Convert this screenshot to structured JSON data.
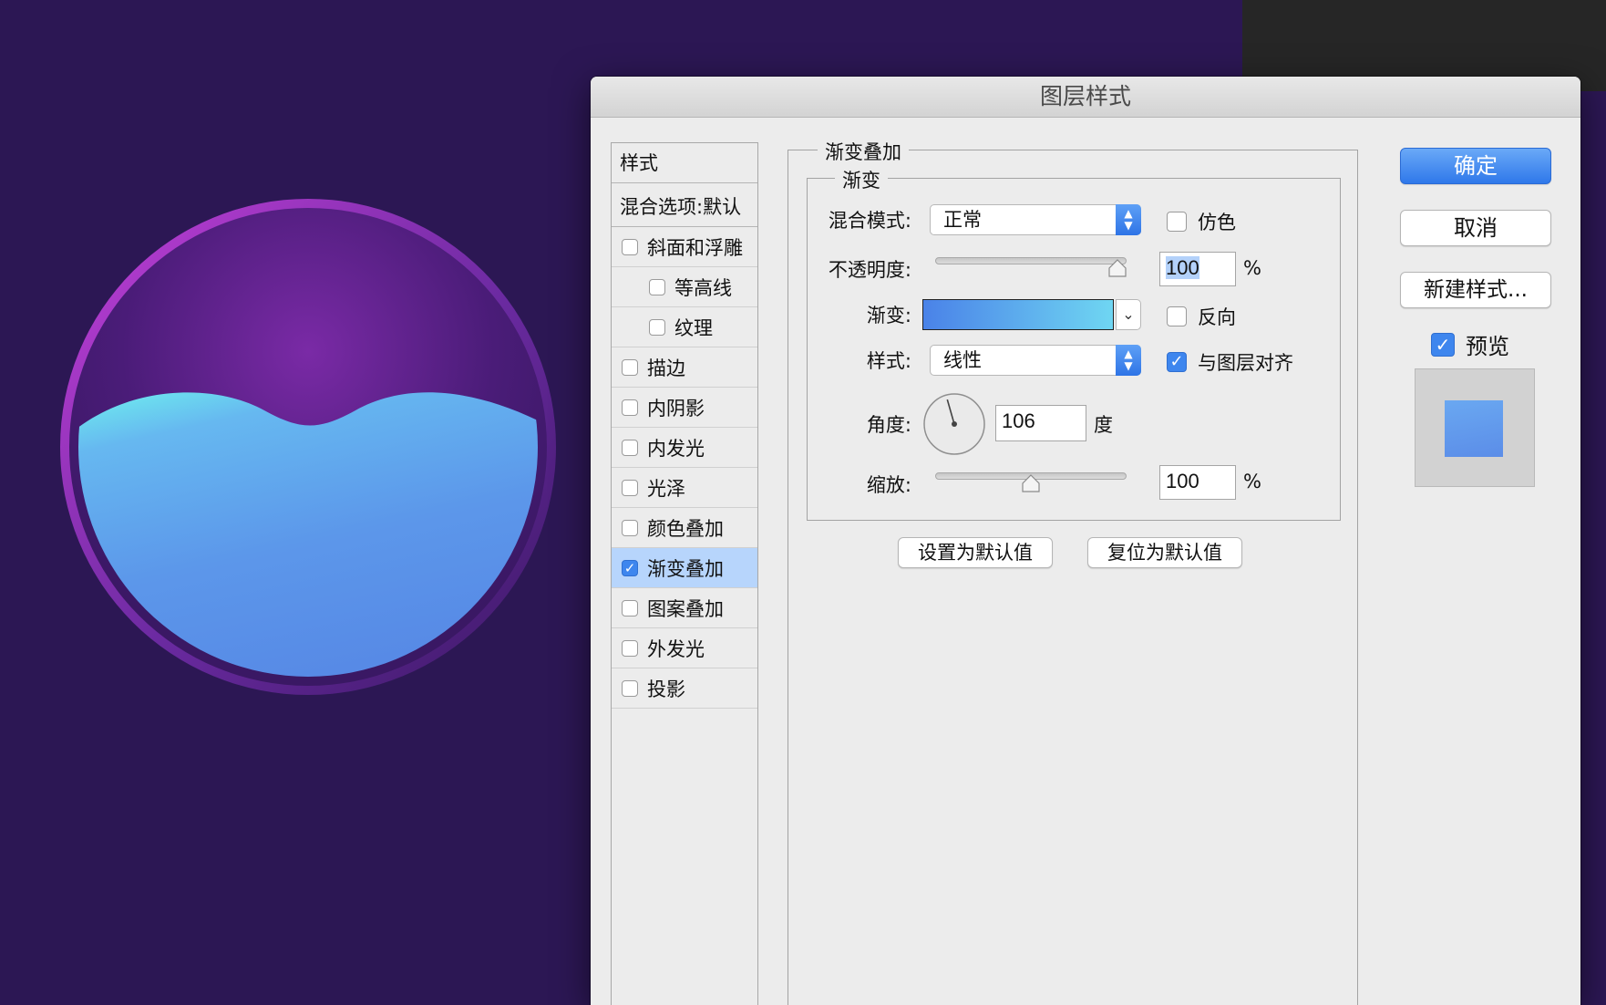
{
  "dialog": {
    "title": "图层样式"
  },
  "style_list": {
    "header": "样式",
    "blend_options": "混合选项:默认",
    "items": [
      {
        "label": "斜面和浮雕",
        "checked": false,
        "sub": false
      },
      {
        "label": "等高线",
        "checked": false,
        "sub": true
      },
      {
        "label": "纹理",
        "checked": false,
        "sub": true
      },
      {
        "label": "描边",
        "checked": false,
        "sub": false
      },
      {
        "label": "内阴影",
        "checked": false,
        "sub": false
      },
      {
        "label": "内发光",
        "checked": false,
        "sub": false
      },
      {
        "label": "光泽",
        "checked": false,
        "sub": false
      },
      {
        "label": "颜色叠加",
        "checked": false,
        "sub": false
      },
      {
        "label": "渐变叠加",
        "checked": true,
        "sub": false,
        "selected": true
      },
      {
        "label": "图案叠加",
        "checked": false,
        "sub": false
      },
      {
        "label": "外发光",
        "checked": false,
        "sub": false
      },
      {
        "label": "投影",
        "checked": false,
        "sub": false
      }
    ]
  },
  "gradient_overlay": {
    "section_title": "渐变叠加",
    "group_title": "渐变",
    "blend_mode_label": "混合模式:",
    "blend_mode_value": "正常",
    "dither_label": "仿色",
    "dither_checked": false,
    "opacity_label": "不透明度:",
    "opacity_value": "100",
    "opacity_unit": "%",
    "opacity_fraction": 1.0,
    "gradient_label": "渐变:",
    "gradient_colors": [
      "#4a82e8",
      "#6fd6f2"
    ],
    "reverse_label": "反向",
    "reverse_checked": false,
    "style_label": "样式:",
    "style_value": "线性",
    "align_label": "与图层对齐",
    "align_checked": true,
    "angle_label": "角度:",
    "angle_value": "106",
    "angle_unit": "度",
    "scale_label": "缩放:",
    "scale_value": "100",
    "scale_unit": "%",
    "scale_fraction": 0.5,
    "set_default_button": "设置为默认值",
    "reset_default_button": "复位为默认值"
  },
  "actions": {
    "ok": "确定",
    "cancel": "取消",
    "new_style": "新建样式...",
    "preview_label": "预览",
    "preview_checked": true
  },
  "colors": {
    "canvas_bg": "#2c1754",
    "accent": "#3e86ee",
    "selection": "#b7d5fc"
  }
}
